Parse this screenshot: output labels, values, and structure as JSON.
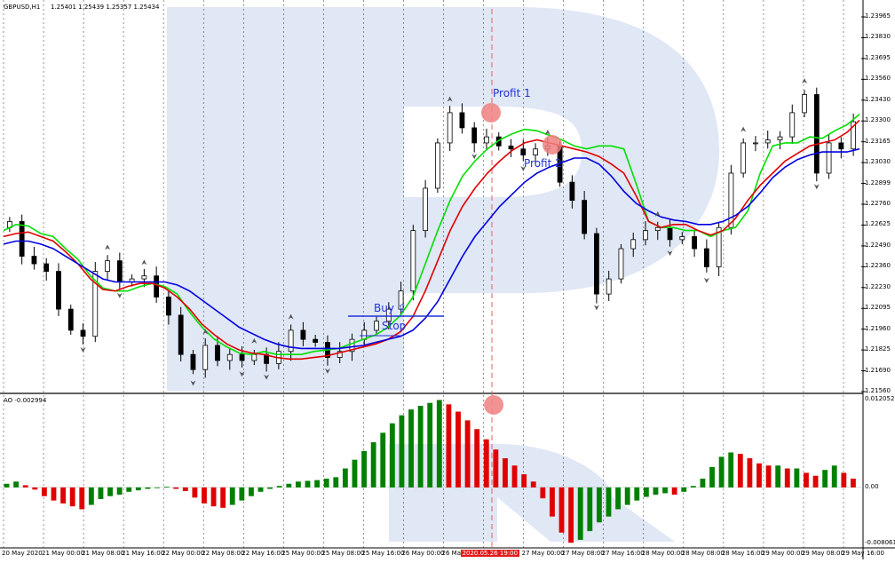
{
  "chart_info": {
    "symbol_label": "GBPUSD,H1",
    "ohlc_label": "1.25401 1.25439 1.25357 1.25434"
  },
  "ao_info": {
    "label": "AO -0.002994"
  },
  "annotations": {
    "buy": "Buy ⇧",
    "stop": "Stop",
    "profit1": "Profit 1",
    "profit2": "Profit 2"
  },
  "colors": {
    "green_ma": "#00e000",
    "red_ma": "#e00000",
    "blue_ma": "#0000e0",
    "ao_up": "#008000",
    "ao_down": "#e00000",
    "marker": "#f08080",
    "vline": "#e06060"
  },
  "chart_data": [
    {
      "type": "candlestick",
      "title": "GBPUSD,H1",
      "y_axis_ticks": [
        "1.23965",
        "1.23830",
        "1.23695",
        "1.23560",
        "1.23430",
        "1.23300",
        "1.23165",
        "1.23030",
        "1.22899",
        "1.22760",
        "1.22625",
        "1.22490",
        "1.22360",
        "1.22230",
        "1.22095",
        "1.21960",
        "1.21825",
        "1.21690",
        "1.21560"
      ],
      "ylim": [
        1.2156,
        1.2404
      ],
      "x_axis_ticks": [
        "20 May 2020",
        "21 May 00:00",
        "21 May 08:00",
        "21 May 16:00",
        "22 May 00:00",
        "22 May 08:00",
        "22 May 16:00",
        "25 May 00:00",
        "25 May 08:00",
        "25 May 16:00",
        "26 May 00:00",
        "26 May 08:00",
        "2020.05.26 19:00",
        "27 May 00:00",
        "27 May 08:00",
        "27 May 16:00",
        "28 May 00:00",
        "28 May 08:00",
        "28 May 16:00",
        "29 May 00:00",
        "29 May 08:00",
        "29 May 16:00"
      ],
      "highlighted_x_tick": "2020.05.26 19:00",
      "series": [
        {
          "name": "green MA",
          "color": "#00e000",
          "values": [
            1.2262,
            1.2266,
            1.2265,
            1.226,
            1.2258,
            1.225,
            1.2243,
            1.2232,
            1.2224,
            1.2222,
            1.2222,
            1.2225,
            1.2227,
            1.2225,
            1.222,
            1.2208,
            1.2198,
            1.219,
            1.2185,
            1.2181,
            1.218,
            1.2182,
            1.218,
            1.218,
            1.218,
            1.2182,
            1.2183,
            1.2184,
            1.2187,
            1.219,
            1.2193,
            1.2198,
            1.2206,
            1.2218,
            1.224,
            1.2262,
            1.2282,
            1.2298,
            1.2308,
            1.2316,
            1.2322,
            1.2326,
            1.2329,
            1.2328,
            1.2325,
            1.2322,
            1.2318,
            1.2316,
            1.2318,
            1.2318,
            1.2316,
            1.2293,
            1.2268,
            1.2264,
            1.2264,
            1.2262,
            1.2262,
            1.2258,
            1.2262,
            1.2264,
            1.2275,
            1.23,
            1.2318,
            1.232,
            1.232,
            1.2324,
            1.2323,
            1.2328,
            1.2332,
            1.2339
          ]
        },
        {
          "name": "red MA",
          "color": "#e00000",
          "values": [
            1.2258,
            1.226,
            1.2261,
            1.2258,
            1.2255,
            1.2248,
            1.224,
            1.223,
            1.2223,
            1.2222,
            1.2225,
            1.2227,
            1.2227,
            1.2224,
            1.2218,
            1.221,
            1.22,
            1.2193,
            1.2187,
            1.2183,
            1.2181,
            1.218,
            1.2178,
            1.2177,
            1.2177,
            1.2178,
            1.2179,
            1.2181,
            1.2183,
            1.2185,
            1.2187,
            1.219,
            1.2195,
            1.2205,
            1.2222,
            1.2242,
            1.2262,
            1.2278,
            1.229,
            1.23,
            1.2308,
            1.2315,
            1.232,
            1.2322,
            1.232,
            1.2318,
            1.2316,
            1.2314,
            1.2311,
            1.2306,
            1.23,
            1.2285,
            1.2268,
            1.2264,
            1.2266,
            1.2266,
            1.2262,
            1.2259,
            1.2262,
            1.227,
            1.2282,
            1.2292,
            1.23,
            1.2308,
            1.2313,
            1.2318,
            1.232,
            1.2322,
            1.2327,
            1.2335
          ]
        },
        {
          "name": "blue MA",
          "color": "#0000e0",
          "values": [
            1.2253,
            1.2255,
            1.2255,
            1.2253,
            1.225,
            1.2245,
            1.224,
            1.2235,
            1.223,
            1.2228,
            1.2228,
            1.2228,
            1.2228,
            1.2228,
            1.2226,
            1.2222,
            1.2216,
            1.221,
            1.2204,
            1.2198,
            1.2194,
            1.219,
            1.2187,
            1.2185,
            1.2184,
            1.2184,
            1.2184,
            1.2184,
            1.2185,
            1.2186,
            1.2188,
            1.219,
            1.2192,
            1.2196,
            1.2204,
            1.2215,
            1.223,
            1.2245,
            1.2258,
            1.2268,
            1.2278,
            1.2286,
            1.2294,
            1.23,
            1.2304,
            1.2307,
            1.231,
            1.231,
            1.2306,
            1.2298,
            1.2288,
            1.228,
            1.2275,
            1.2271,
            1.2269,
            1.2268,
            1.2266,
            1.2266,
            1.2268,
            1.2272,
            1.2278,
            1.2287,
            1.2297,
            1.2304,
            1.2309,
            1.2312,
            1.2314,
            1.2314,
            1.2314,
            1.2316
          ]
        },
        {
          "name": "close",
          "values": [
            1.2268,
            1.2245,
            1.224,
            1.2235,
            1.221,
            1.2196,
            1.2192,
            1.2235,
            1.2242,
            1.2228,
            1.223,
            1.2232,
            1.2218,
            1.2206,
            1.218,
            1.217,
            1.2186,
            1.2176,
            1.218,
            1.2176,
            1.218,
            1.2174,
            1.2182,
            1.2196,
            1.219,
            1.2188,
            1.2178,
            1.2182,
            1.219,
            1.2196,
            1.2202,
            1.221,
            1.2222,
            1.2262,
            1.229,
            1.232,
            1.234,
            1.233,
            1.232,
            1.2324,
            1.2318,
            1.2316,
            1.2312,
            1.2316,
            1.2318,
            1.2294,
            1.2282,
            1.226,
            1.222,
            1.223,
            1.225,
            1.2256,
            1.2262,
            1.2264,
            1.2256,
            1.2258,
            1.225,
            1.2238,
            1.2264,
            1.23,
            1.232,
            1.232,
            1.2322,
            1.2324,
            1.234,
            1.2352,
            1.23,
            1.232,
            1.2316,
            1.2334
          ]
        }
      ]
    },
    {
      "type": "bar",
      "title": "AO",
      "y_axis_ticks": [
        "0.012052",
        "0.00",
        "-0.008061"
      ],
      "ylim": [
        -0.008061,
        0.012052
      ],
      "series": [
        {
          "name": "AO",
          "values": [
            0.0005,
            0.0008,
            0.0003,
            -0.0003,
            -0.0012,
            -0.0018,
            -0.0022,
            -0.0026,
            -0.003,
            -0.0024,
            -0.0016,
            -0.0012,
            -0.001,
            -0.0006,
            -0.0004,
            -0.0002,
            0.0,
            0.0001,
            -0.0002,
            -0.0005,
            -0.0014,
            -0.0022,
            -0.0026,
            -0.0028,
            -0.0024,
            -0.0018,
            -0.0012,
            -0.0006,
            -0.0002,
            0.0002,
            0.0005,
            0.0008,
            0.0009,
            0.001,
            0.0012,
            0.0014,
            0.0026,
            0.0038,
            0.005,
            0.0062,
            0.0075,
            0.0088,
            0.0099,
            0.0107,
            0.0112,
            0.0116,
            0.012,
            0.0114,
            0.0104,
            0.0092,
            0.008,
            0.0066,
            0.0052,
            0.004,
            0.003,
            0.0018,
            0.0008,
            -0.0015,
            -0.004,
            -0.0062,
            -0.0076,
            -0.0072,
            -0.006,
            -0.0048,
            -0.004,
            -0.003,
            -0.0024,
            -0.0018,
            -0.0013,
            -0.001,
            -0.0008,
            -0.001,
            -0.0006,
            0.0002,
            0.0012,
            0.0028,
            0.0042,
            0.0048,
            0.0046,
            0.004,
            0.0033,
            0.003,
            0.003,
            0.0026,
            0.0026,
            0.002,
            0.0016,
            0.0024,
            0.003,
            0.002,
            0.0012
          ]
        }
      ]
    }
  ]
}
